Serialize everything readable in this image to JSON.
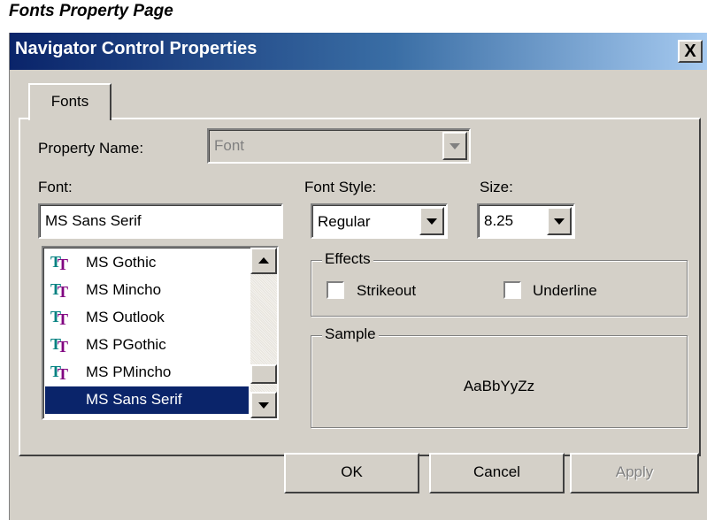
{
  "caption": "Fonts Property Page",
  "window": {
    "title": "Navigator Control Properties",
    "close": "X"
  },
  "tabs": [
    {
      "label": "Fonts"
    }
  ],
  "property_name": {
    "label": "Property Name:",
    "value": "Font"
  },
  "font": {
    "label": "Font:",
    "value": "MS Sans Serif",
    "list": [
      {
        "name": "MS Gothic",
        "icon": "truetype-font-icon"
      },
      {
        "name": "MS Mincho",
        "icon": "truetype-font-icon"
      },
      {
        "name": "MS Outlook",
        "icon": "truetype-font-icon"
      },
      {
        "name": "MS PGothic",
        "icon": "truetype-font-icon"
      },
      {
        "name": "MS PMincho",
        "icon": "truetype-font-icon"
      },
      {
        "name": "MS Sans Serif",
        "icon": "",
        "selected": true
      }
    ]
  },
  "font_style": {
    "label": "Font Style:",
    "value": "Regular"
  },
  "size": {
    "label": "Size:",
    "value": "8.25"
  },
  "effects": {
    "label": "Effects",
    "strikeout": {
      "label": "Strikeout",
      "checked": false
    },
    "underline": {
      "label": "Underline",
      "checked": false
    }
  },
  "sample": {
    "label": "Sample",
    "text": "AaBbYyZz"
  },
  "buttons": {
    "ok": "OK",
    "cancel": "Cancel",
    "apply": "Apply"
  },
  "colors": {
    "title_bar": "#0a246a",
    "dialog_bg": "#d4d0c8",
    "selection": "#0a246a"
  }
}
